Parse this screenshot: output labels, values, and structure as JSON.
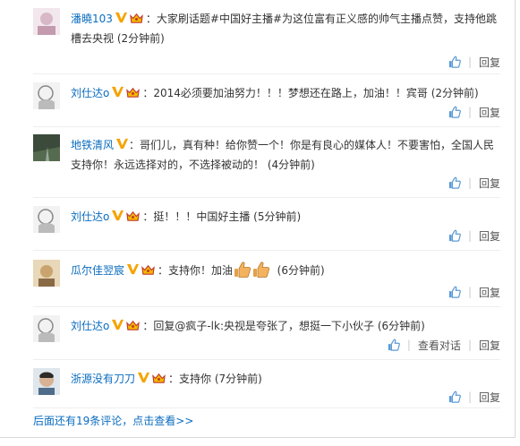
{
  "comments": [
    {
      "author": "潘曉103",
      "text": "：大家刷话题#中国好主播#为这位富有正义感的帅气主播点赞，支持他跳槽去央视 ",
      "time": "(2分钟前)",
      "reply_label": "回复"
    },
    {
      "author": "刘仕达o",
      "text": "：2014必须要加油努力！！！梦想还在路上，加油！！宾哥 ",
      "time": "(2分钟前)",
      "reply_label": "回复"
    },
    {
      "author": "地铁清风",
      "text": "：哥们儿，真有种！给你赞一个！你是有良心的媒体人！不要害怕，全国人民支持你！永远选择对的，不选择被动的！ ",
      "time": "(4分钟前)",
      "reply_label": "回复"
    },
    {
      "author": "刘仕达o",
      "text": "：挺！！！中国好主播 ",
      "time": "(5分钟前)",
      "reply_label": "回复"
    },
    {
      "author": "瓜尔佳翌宸",
      "text": "：支持你！加油",
      "time": "(6分钟前)",
      "reply_label": "回复"
    },
    {
      "author": "刘仕达o",
      "text": "：回复@疯子-lk:央视是夸张了，想挺一下小伙子 ",
      "time": "(6分钟前)",
      "view_dialog_label": "查看对话",
      "reply_label": "回复"
    },
    {
      "author": "浙源没有刀刀",
      "text": "：支持你 ",
      "time": "(7分钟前)",
      "reply_label": "回复"
    }
  ],
  "more_link": "后面还有19条评论，点击查看>>",
  "icons": {
    "verified": "verified-v-icon",
    "crown": "vip-crown-icon",
    "like": "thumbs-up-icon",
    "thumbs_emoji": "thumbs-up-emoji-icon"
  },
  "colors": {
    "link": "#0a6cbf",
    "verified": "#f5a300",
    "like": "#5c9bd6"
  }
}
